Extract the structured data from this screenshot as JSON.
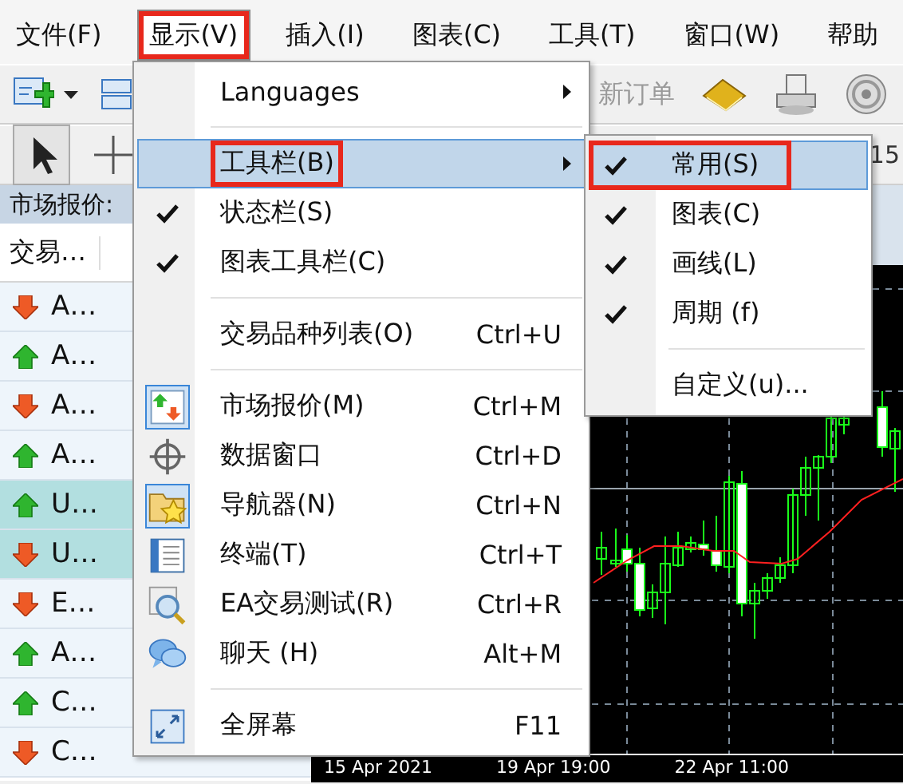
{
  "menubar": [
    {
      "label": "文件(F)",
      "selected": false,
      "annotated": false
    },
    {
      "label": "显示(V)",
      "selected": true,
      "annotated": true
    },
    {
      "label": "插入(I)",
      "selected": false,
      "annotated": false
    },
    {
      "label": "图表(C)",
      "selected": false,
      "annotated": false
    },
    {
      "label": "工具(T)",
      "selected": false,
      "annotated": false
    },
    {
      "label": "窗口(W)",
      "selected": false,
      "annotated": false
    },
    {
      "label": "帮助",
      "selected": false,
      "annotated": false
    }
  ],
  "toolbar_1": {
    "new_order": {
      "label": "新订单",
      "disabled": true
    }
  },
  "toolbar_2": {
    "cursor_selected": true,
    "period_label": "15"
  },
  "market_watch": {
    "title": "市场报价:",
    "columns": [
      "交易…"
    ],
    "rows": [
      {
        "symbol": "A…",
        "rising": false,
        "selected": false
      },
      {
        "symbol": "A…",
        "rising": true,
        "selected": false
      },
      {
        "symbol": "A…",
        "rising": false,
        "selected": false
      },
      {
        "symbol": "A…",
        "rising": true,
        "selected": false
      },
      {
        "symbol": "U…",
        "rising": true,
        "selected": true
      },
      {
        "symbol": "U…",
        "rising": false,
        "selected": true
      },
      {
        "symbol": "E…",
        "rising": false,
        "selected": false
      },
      {
        "symbol": "A…",
        "rising": true,
        "selected": false
      },
      {
        "symbol": "C…",
        "rising": true,
        "selected": false
      },
      {
        "symbol": "C…",
        "rising": false,
        "selected": false
      }
    ]
  },
  "view_menu": {
    "items": [
      {
        "kind": "submenu",
        "label": "Languages",
        "selected": false,
        "annotated": false
      },
      {
        "kind": "separator"
      },
      {
        "kind": "submenu",
        "label": "工具栏(B)",
        "selected": true,
        "annotated": true
      },
      {
        "kind": "check",
        "label": "状态栏(S)",
        "checked": true
      },
      {
        "kind": "check",
        "label": "图表工具栏(C)",
        "checked": true
      },
      {
        "kind": "separator"
      },
      {
        "kind": "item",
        "label": "交易品种列表(O)",
        "shortcut": "Ctrl+U"
      },
      {
        "kind": "separator"
      },
      {
        "kind": "tool",
        "label": "市场报价(M)",
        "shortcut": "Ctrl+M",
        "active": true
      },
      {
        "kind": "tool",
        "label": "数据窗口",
        "shortcut": "Ctrl+D",
        "active": false
      },
      {
        "kind": "tool",
        "label": "导航器(N)",
        "shortcut": "Ctrl+N",
        "active": true
      },
      {
        "kind": "tool",
        "label": "终端(T)",
        "shortcut": "Ctrl+T",
        "active": false
      },
      {
        "kind": "tool",
        "label": "EA交易测试(R)",
        "shortcut": "Ctrl+R",
        "active": false
      },
      {
        "kind": "tool",
        "label": "聊天 (H)",
        "shortcut": "Alt+M",
        "active": false
      },
      {
        "kind": "separator"
      },
      {
        "kind": "tool",
        "label": "全屏幕",
        "shortcut": "F11",
        "active": false
      }
    ]
  },
  "toolbars_submenu": {
    "items": [
      {
        "kind": "check",
        "label": "常用(S)",
        "checked": true,
        "selected": true,
        "annotated": true
      },
      {
        "kind": "check",
        "label": "图表(C)",
        "checked": true,
        "selected": false,
        "annotated": false
      },
      {
        "kind": "check",
        "label": "画线(L)",
        "checked": true,
        "selected": false,
        "annotated": false
      },
      {
        "kind": "check",
        "label": "周期 (f)",
        "checked": true,
        "selected": false,
        "annotated": false
      },
      {
        "kind": "separator"
      },
      {
        "kind": "item",
        "label": "自定义(u)...",
        "selected": false,
        "annotated": false
      }
    ]
  },
  "chart": {
    "time_labels": [
      "15 Apr 2021",
      "19 Apr 19:00",
      "22 Apr 11:00"
    ]
  }
}
